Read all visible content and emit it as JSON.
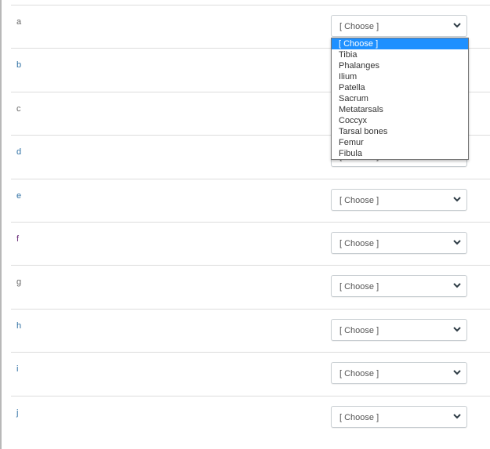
{
  "rows": [
    {
      "label": "a",
      "value": "[ Choose ]",
      "color": "#666666"
    },
    {
      "label": "b",
      "value": "[ Choose ]",
      "color": "#2d6fa3"
    },
    {
      "label": "c",
      "value": "[ Choose ]",
      "color": "#666666"
    },
    {
      "label": "d",
      "value": "[ Choose ]",
      "color": "#2d6fa3"
    },
    {
      "label": "e",
      "value": "[ Choose ]",
      "color": "#2d6fa3"
    },
    {
      "label": "f",
      "value": "[ Choose ]",
      "color": "#6b2d7a"
    },
    {
      "label": "g",
      "value": "[ Choose ]",
      "color": "#666666"
    },
    {
      "label": "h",
      "value": "[ Choose ]",
      "color": "#2d6fa3"
    },
    {
      "label": "i",
      "value": "[ Choose ]",
      "color": "#2d6fa3"
    },
    {
      "label": "j",
      "value": "[ Choose ]",
      "color": "#2d6fa3"
    }
  ],
  "dropdown": {
    "open_for": "a",
    "highlighted": "[ Choose ]",
    "options": [
      "[ Choose ]",
      "Tibia",
      "Phalanges",
      "Ilium",
      "Patella",
      "Sacrum",
      "Metatarsals",
      "Coccyx",
      "Tarsal bones",
      "Femur",
      "Fibula"
    ]
  }
}
